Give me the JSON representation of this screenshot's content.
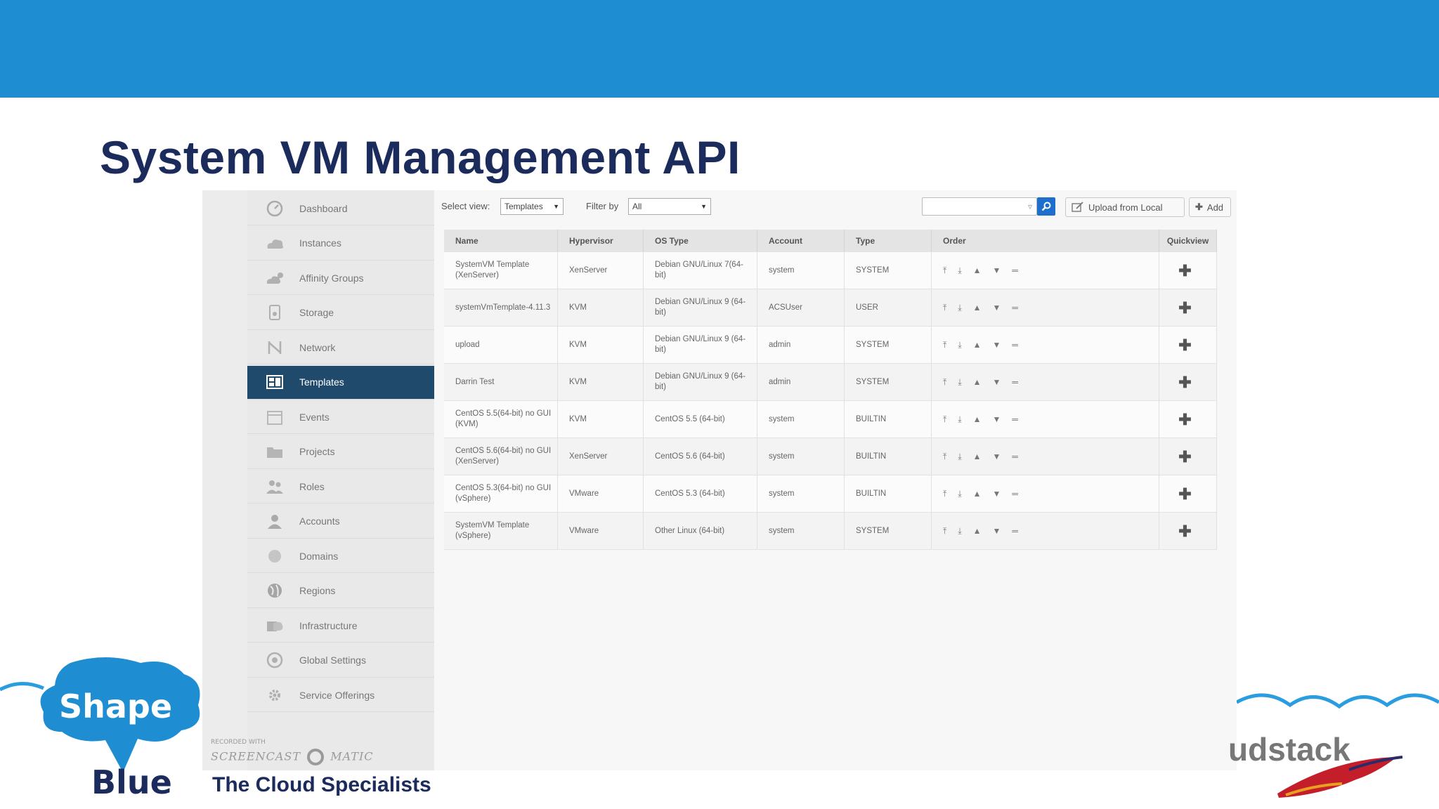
{
  "slide": {
    "title": "System VM Management API",
    "tagline": "The Cloud Specialists",
    "logo_top": "Shape",
    "logo_bottom": "Blue",
    "watermark": "SCREENCAST",
    "watermark_small": "RECORDED WITH",
    "watermark_suffix": "MATIC",
    "partner_logo_text": "udstack",
    "colors": {
      "banner": "#1e8dd2",
      "title": "#1b2b5c",
      "active_nav": "#1f4a6b",
      "search_button": "#1e6fcc"
    }
  },
  "sidebar": {
    "items": [
      {
        "label": "Dashboard",
        "icon": "dashboard-icon"
      },
      {
        "label": "Instances",
        "icon": "cloud-icon"
      },
      {
        "label": "Affinity Groups",
        "icon": "affinity-icon"
      },
      {
        "label": "Storage",
        "icon": "storage-icon"
      },
      {
        "label": "Network",
        "icon": "network-icon"
      },
      {
        "label": "Templates",
        "icon": "templates-icon",
        "active": true
      },
      {
        "label": "Events",
        "icon": "events-icon"
      },
      {
        "label": "Projects",
        "icon": "folder-icon"
      },
      {
        "label": "Roles",
        "icon": "roles-icon"
      },
      {
        "label": "Accounts",
        "icon": "user-icon"
      },
      {
        "label": "Domains",
        "icon": "domains-icon"
      },
      {
        "label": "Regions",
        "icon": "globe-icon"
      },
      {
        "label": "Infrastructure",
        "icon": "infrastructure-icon"
      },
      {
        "label": "Global Settings",
        "icon": "global-settings-icon"
      },
      {
        "label": "Service Offerings",
        "icon": "gear-icon"
      }
    ]
  },
  "toolbar": {
    "select_view_label": "Select view:",
    "select_view_value": "Templates",
    "filter_label": "Filter by",
    "filter_value": "All",
    "search_placeholder": "",
    "upload_label": "Upload from Local",
    "add_label": "Add"
  },
  "table": {
    "headers": [
      "Name",
      "Hypervisor",
      "OS Type",
      "Account",
      "Type",
      "Order",
      "Quickview"
    ],
    "rows": [
      {
        "name": "SystemVM Template (XenServer)",
        "hypervisor": "XenServer",
        "os": "Debian GNU/Linux 7(64-bit)",
        "account": "system",
        "type": "SYSTEM"
      },
      {
        "name": "systemVmTemplate-4.11.3",
        "hypervisor": "KVM",
        "os": "Debian GNU/Linux 9 (64-bit)",
        "account": "ACSUser",
        "type": "USER"
      },
      {
        "name": "upload",
        "hypervisor": "KVM",
        "os": "Debian GNU/Linux 9 (64-bit)",
        "account": "admin",
        "type": "SYSTEM"
      },
      {
        "name": "Darrin Test",
        "hypervisor": "KVM",
        "os": "Debian GNU/Linux 9 (64-bit)",
        "account": "admin",
        "type": "SYSTEM"
      },
      {
        "name": "CentOS 5.5(64-bit) no GUI (KVM)",
        "hypervisor": "KVM",
        "os": "CentOS 5.5 (64-bit)",
        "account": "system",
        "type": "BUILTIN"
      },
      {
        "name": "CentOS 5.6(64-bit) no GUI (XenServer)",
        "hypervisor": "XenServer",
        "os": "CentOS 5.6 (64-bit)",
        "account": "system",
        "type": "BUILTIN"
      },
      {
        "name": "CentOS 5.3(64-bit) no GUI (vSphere)",
        "hypervisor": "VMware",
        "os": "CentOS 5.3 (64-bit)",
        "account": "system",
        "type": "BUILTIN"
      },
      {
        "name": "SystemVM Template (vSphere)",
        "hypervisor": "VMware",
        "os": "Other Linux (64-bit)",
        "account": "system",
        "type": "SYSTEM"
      }
    ]
  }
}
